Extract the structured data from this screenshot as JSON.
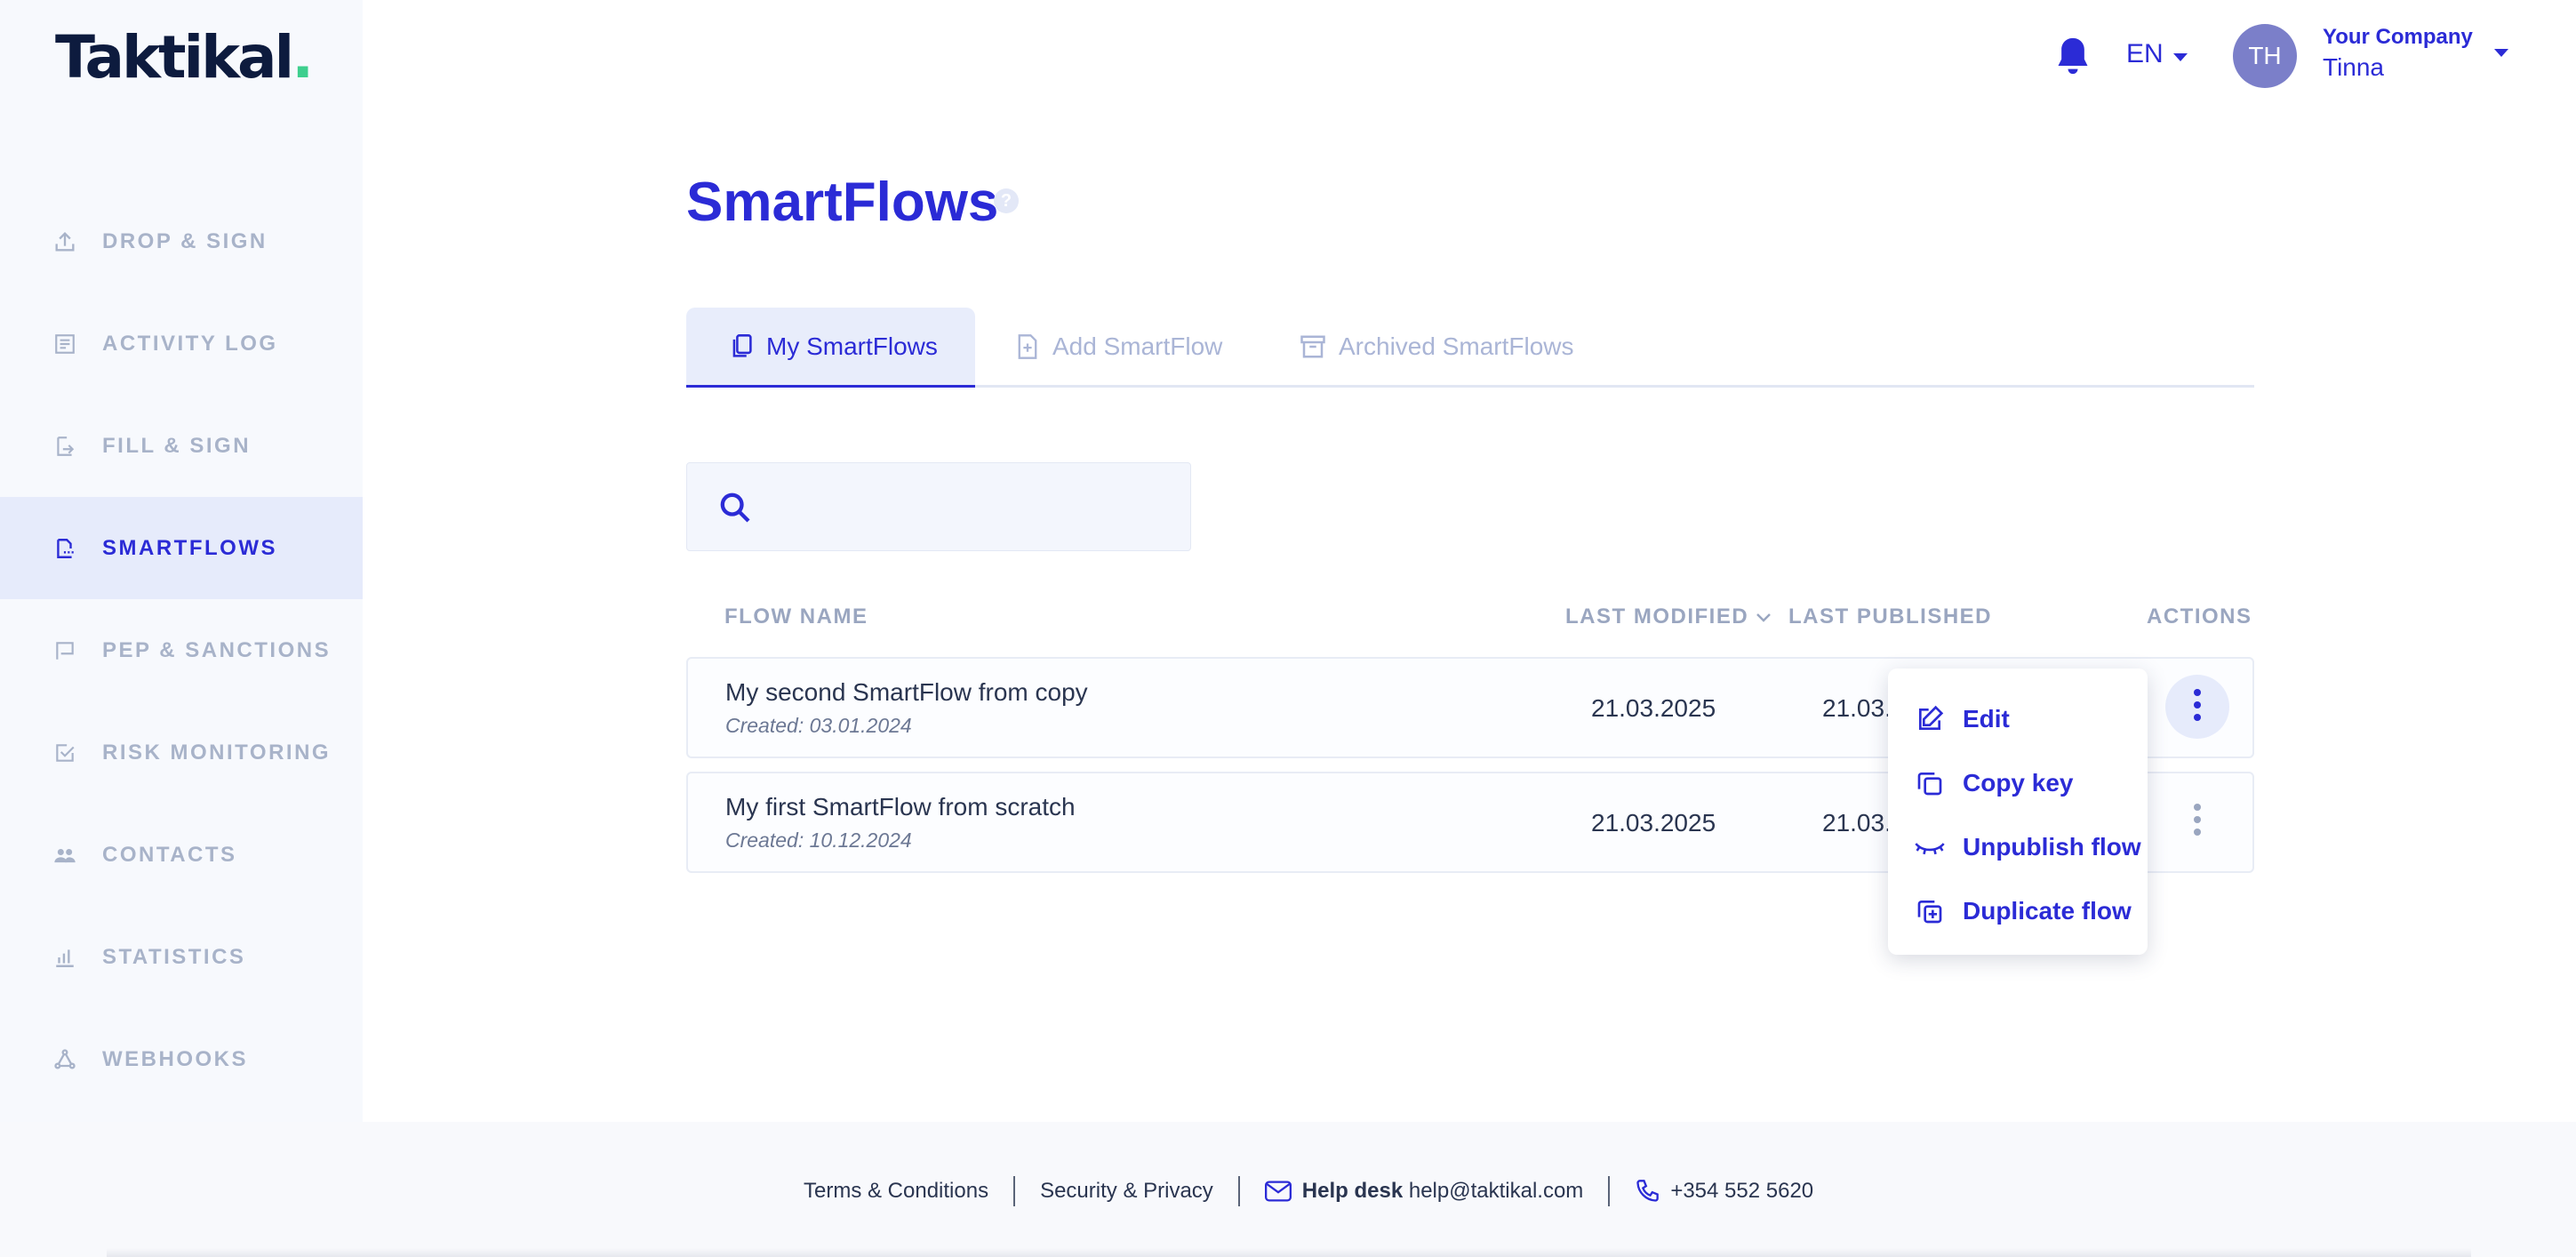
{
  "logo": {
    "text": "Taktikal",
    "dot": "."
  },
  "sidebar": {
    "items": [
      {
        "label": "DROP & SIGN",
        "icon": "upload-icon"
      },
      {
        "label": "ACTIVITY LOG",
        "icon": "list-icon"
      },
      {
        "label": "FILL & SIGN",
        "icon": "fill-sign-icon"
      },
      {
        "label": "SMARTFLOWS",
        "icon": "smartflow-icon",
        "active": true
      },
      {
        "label": "PEP & SANCTIONS",
        "icon": "flag-icon"
      },
      {
        "label": "RISK MONITORING",
        "icon": "checkbox-icon"
      },
      {
        "label": "CONTACTS",
        "icon": "people-icon"
      },
      {
        "label": "STATISTICS",
        "icon": "bar-chart-icon"
      },
      {
        "label": "WEBHOOKS",
        "icon": "webhook-icon"
      }
    ]
  },
  "header": {
    "language": "EN",
    "avatar_initials": "TH",
    "company": "Your Company",
    "user": "Tinna"
  },
  "page": {
    "title": "SmartFlows",
    "help": "?"
  },
  "tabs": [
    {
      "label": "My SmartFlows",
      "active": true
    },
    {
      "label": "Add SmartFlow"
    },
    {
      "label": "Archived SmartFlows"
    }
  ],
  "search": {
    "value": "",
    "placeholder": ""
  },
  "table": {
    "headers": {
      "flow_name": "FLOW NAME",
      "last_modified": "LAST MODIFIED",
      "last_published": "LAST PUBLISHED",
      "actions": "ACTIONS"
    },
    "rows": [
      {
        "name": "My second SmartFlow from copy",
        "created": "Created: 03.01.2024",
        "modified": "21.03.2025",
        "published": "21.03."
      },
      {
        "name": "My first SmartFlow from scratch",
        "created": "Created: 10.12.2024",
        "modified": "21.03.2025",
        "published": "21.03."
      }
    ]
  },
  "actions_menu": {
    "items": [
      {
        "label": "Edit",
        "icon": "edit-icon"
      },
      {
        "label": "Copy key",
        "icon": "copy-icon"
      },
      {
        "label": "Unpublish flow",
        "icon": "eye-closed-icon"
      },
      {
        "label": "Duplicate flow",
        "icon": "duplicate-icon"
      }
    ]
  },
  "footer": {
    "terms": "Terms & Conditions",
    "security": "Security & Privacy",
    "helpdesk_label": "Help desk",
    "helpdesk_email": "help@taktikal.com",
    "phone": "+354 552 5620"
  },
  "colors": {
    "accent": "#2b2bd6",
    "sidebar_bg": "#f7f9fd",
    "active_bg": "#e6ebfb",
    "muted": "#a8b3c9",
    "logo_dot": "#3ecf8e"
  }
}
